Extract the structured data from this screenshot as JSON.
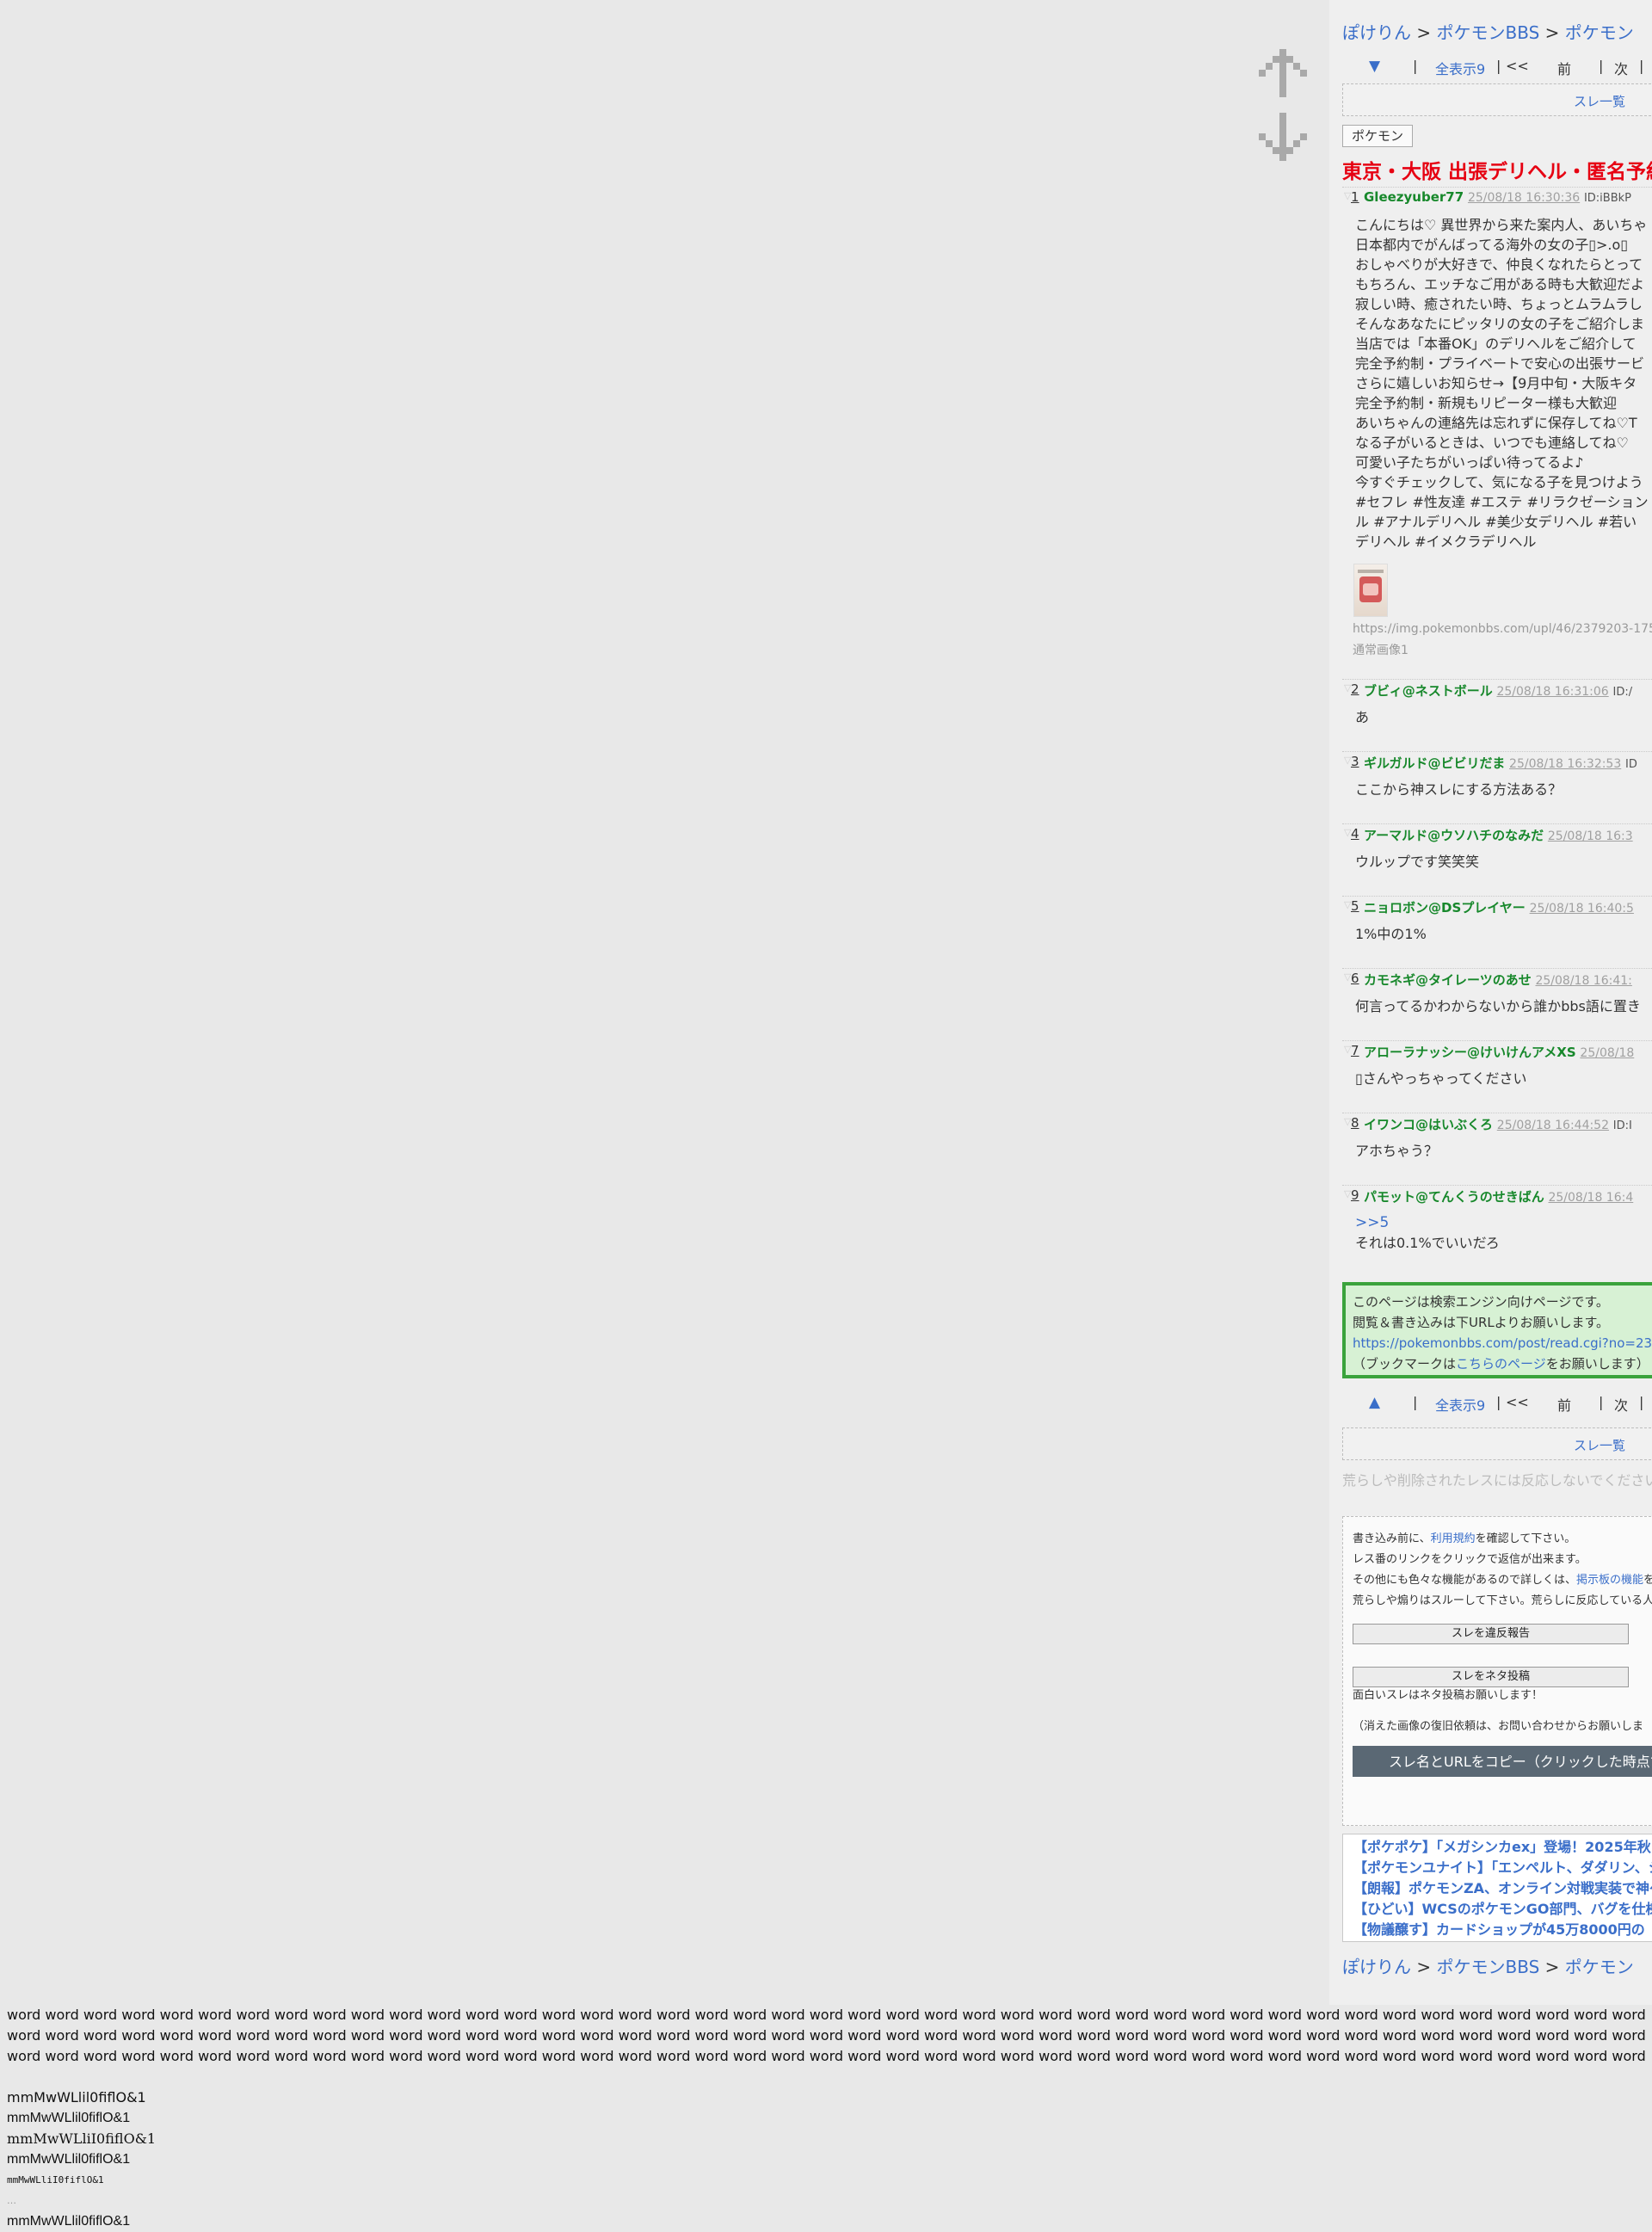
{
  "breadcrumb": {
    "items": [
      "ぽけりん",
      "ポケモンBBS",
      "ポケモン"
    ],
    "separator": ">"
  },
  "pager": {
    "down_arrow": "▼",
    "up_arrow": "▲",
    "separator": "|",
    "show_all": "全表示9",
    "first": "<<",
    "prev": "前",
    "next": "次"
  },
  "thread_list_link": "スレ一覧",
  "category_tag": "ポケモン",
  "thread_title": "東京・大阪 出張デリヘル・匿名予約",
  "posts": [
    {
      "num": "1",
      "name": "Gleezyuber77",
      "date": "25/08/18 16:30:36",
      "id": "ID:iBBkP",
      "lines": [
        "こんにちは♡ 異世界から来た案内人、あいちゃ",
        "日本都内でがんばってる海外の女の子▯>.o▯",
        "おしゃべりが大好きで、仲良くなれたらとって",
        "もちろん、エッチなご用がある時も大歓迎だよ",
        "寂しい時、癒されたい時、ちょっとムラムラし",
        "そんなあなたにピッタリの女の子をご紹介しま",
        "当店では「本番OK」のデリヘルをご紹介して",
        "完全予約制・プライベートで安心の出張サービ",
        "さらに嬉しいお知らせ→【9月中旬・大阪キタ",
        "完全予約制・新規もリピーター様も大歓迎",
        "あいちゃんの連絡先は忘れずに保存してね♡T",
        "なる子がいるときは、いつでも連絡してね♡",
        "可愛い子たちがいっぱい待ってるよ♪",
        "今すぐチェックして、気になる子を見つけよう",
        "#セフレ #性友達 #エステ #リラクゼーション",
        "ル #アナルデリヘル #美少女デリヘル #若い",
        "デリヘル #イメクラデリヘル"
      ],
      "image_url": "https://img.pokemonbbs.com/upl/46/2379203-175",
      "image_caption": "通常画像1"
    },
    {
      "num": "2",
      "name": "ブビィ@ネストボール",
      "date": "25/08/18 16:31:06",
      "id": "ID:/",
      "lines": [
        "あ"
      ]
    },
    {
      "num": "3",
      "name": "ギルガルド@ビビリだま",
      "date": "25/08/18 16:32:53",
      "id": "ID",
      "lines": [
        "ここから神スレにする方法ある？"
      ]
    },
    {
      "num": "4",
      "name": "アーマルド@ウソハチのなみだ",
      "date": "25/08/18 16:3",
      "id": "",
      "lines": [
        "ウルップです笑笑笑"
      ]
    },
    {
      "num": "5",
      "name": "ニョロボン@DSプレイヤー",
      "date": "25/08/18 16:40:5",
      "id": "",
      "lines": [
        "1%中の1%"
      ]
    },
    {
      "num": "6",
      "name": "カモネギ@タイレーツのあせ",
      "date": "25/08/18 16:41:",
      "id": "",
      "lines": [
        "何言ってるかわからないから誰かbbs語に置き"
      ]
    },
    {
      "num": "7",
      "name": "アローラナッシー@けいけんアメXS",
      "date": "25/08/18",
      "id": "",
      "lines": [
        "▯さんやっちゃってください"
      ]
    },
    {
      "num": "8",
      "name": "イワンコ@はいぶくろ",
      "date": "25/08/18 16:44:52",
      "id": "ID:I",
      "lines": [
        "アホちゃう？"
      ]
    },
    {
      "num": "9",
      "name": "パモット@てんくうのせきばん",
      "date": "25/08/18 16:4",
      "id": "",
      "anchor": ">>5",
      "lines": [
        "それは0.1%でいいだろ"
      ]
    }
  ],
  "notice": {
    "line1": "このページは検索エンジン向けページです。",
    "line2": "閲覧＆書き込みは下URLよりお願いします。",
    "url": "https://pokemonbbs.com/post/read.cgi?no=23",
    "bookmark_pre": "（ブックマークは",
    "bookmark_link": "こちらのページ",
    "bookmark_post": "をお願いします）"
  },
  "warning": "荒らしや削除されたレスには反応しないでください",
  "rules": {
    "l1_pre": "書き込み前に、",
    "l1_link": "利用規約",
    "l1_post": "を確認して下さい。",
    "l2": "レス番のリンクをクリックで返信が出来ます。",
    "l3_pre": "その他にも色々な機能があるので詳しくは、",
    "l3_link": "掲示板の機能",
    "l3_post": "を",
    "l4": "荒らしや煽りはスルーして下さい。荒らしに反応している人",
    "report_button": "スレを違反報告",
    "neta_button": "スレをネタ投稿",
    "neta_note": "面白いスレはネタ投稿お願いします！",
    "restore_note": "（消えた画像の復旧依頼は、お問い合わせからお願いしま",
    "copy_button": "スレ名とURLをコピー（クリックした時点で"
  },
  "news": [
    "【ポケポケ】「メガシンカex」登場！2025年秋",
    "【ポケモンユナイト】「エンペルト、ダダリン、シ",
    "【朗報】ポケモンZA、オンライン対戦実装で神ゲ",
    "【ひどい】WCSのポケモンGO部門、バグを仕様",
    "【物議醸す】カードショップが45万8000円の「"
  ],
  "test_text": {
    "word": "word",
    "word_count": 160,
    "font_sample": "mmMwWLlil0fiflO&1",
    "small_sample": "mmMwWLliI0fiflO&1",
    "ellipsis": "…"
  }
}
